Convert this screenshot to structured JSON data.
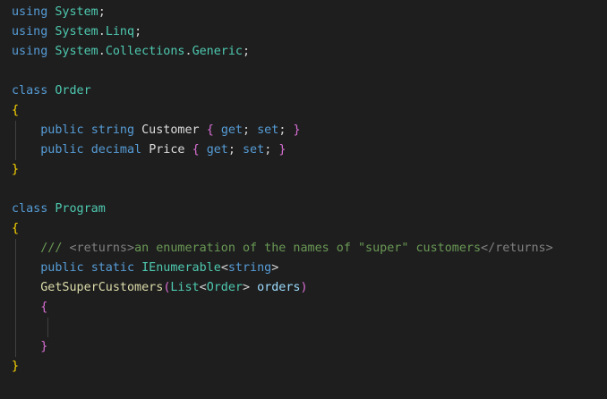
{
  "theme": {
    "background": "#1e1e1e",
    "keyword": "#569cd6",
    "type": "#4ec9b0",
    "method": "#dcdcaa",
    "parameter": "#9cdcfe",
    "comment": "#6a9955",
    "bracket_level_1": "#ffd700",
    "bracket_level_2": "#da70d6",
    "bracket_level_3": "#179fff"
  },
  "code": {
    "lines": [
      [
        {
          "t": "using",
          "c": "kw"
        },
        {
          "t": " "
        },
        {
          "t": "System",
          "c": "type"
        },
        {
          "t": ";"
        }
      ],
      [
        {
          "t": "using",
          "c": "kw"
        },
        {
          "t": " "
        },
        {
          "t": "System",
          "c": "type"
        },
        {
          "t": "."
        },
        {
          "t": "Linq",
          "c": "type"
        },
        {
          "t": ";"
        }
      ],
      [
        {
          "t": "using",
          "c": "kw"
        },
        {
          "t": " "
        },
        {
          "t": "System",
          "c": "type"
        },
        {
          "t": "."
        },
        {
          "t": "Collections",
          "c": "type"
        },
        {
          "t": "."
        },
        {
          "t": "Generic",
          "c": "type"
        },
        {
          "t": ";"
        }
      ],
      [],
      [
        {
          "t": "class",
          "c": "kw"
        },
        {
          "t": " "
        },
        {
          "t": "Order",
          "c": "type"
        }
      ],
      [
        {
          "t": "{",
          "c": "b1"
        }
      ],
      [
        {
          "t": "    "
        },
        {
          "t": "public",
          "c": "kw"
        },
        {
          "t": " "
        },
        {
          "t": "string",
          "c": "kw"
        },
        {
          "t": " "
        },
        {
          "t": "Customer",
          "c": "prop"
        },
        {
          "t": " "
        },
        {
          "t": "{",
          "c": "b2"
        },
        {
          "t": " "
        },
        {
          "t": "get",
          "c": "kw"
        },
        {
          "t": "; "
        },
        {
          "t": "set",
          "c": "kw"
        },
        {
          "t": "; "
        },
        {
          "t": "}",
          "c": "b2"
        }
      ],
      [
        {
          "t": "    "
        },
        {
          "t": "public",
          "c": "kw"
        },
        {
          "t": " "
        },
        {
          "t": "decimal",
          "c": "kw"
        },
        {
          "t": " "
        },
        {
          "t": "Price",
          "c": "prop"
        },
        {
          "t": " "
        },
        {
          "t": "{",
          "c": "b2"
        },
        {
          "t": " "
        },
        {
          "t": "get",
          "c": "kw"
        },
        {
          "t": "; "
        },
        {
          "t": "set",
          "c": "kw"
        },
        {
          "t": "; "
        },
        {
          "t": "}",
          "c": "b2"
        }
      ],
      [
        {
          "t": "}",
          "c": "b1"
        }
      ],
      [],
      [
        {
          "t": "class",
          "c": "kw"
        },
        {
          "t": " "
        },
        {
          "t": "Program",
          "c": "type"
        }
      ],
      [
        {
          "t": "{",
          "c": "b1"
        }
      ],
      [
        {
          "t": "    "
        },
        {
          "t": "/// ",
          "c": "comment"
        },
        {
          "t": "<returns>",
          "c": "tag"
        },
        {
          "t": "an enumeration of the names of \"super\" customers",
          "c": "comment"
        },
        {
          "t": "</returns>",
          "c": "tag"
        }
      ],
      [
        {
          "t": "    "
        },
        {
          "t": "public",
          "c": "kw"
        },
        {
          "t": " "
        },
        {
          "t": "static",
          "c": "kw"
        },
        {
          "t": " "
        },
        {
          "t": "IEnumerable",
          "c": "type"
        },
        {
          "t": "<"
        },
        {
          "t": "string",
          "c": "kw"
        },
        {
          "t": ">"
        }
      ],
      [
        {
          "t": "    "
        },
        {
          "t": "GetSuperCustomers",
          "c": "method"
        },
        {
          "t": "(",
          "c": "b2"
        },
        {
          "t": "List",
          "c": "type"
        },
        {
          "t": "<"
        },
        {
          "t": "Order",
          "c": "type"
        },
        {
          "t": "> "
        },
        {
          "t": "orders",
          "c": "param"
        },
        {
          "t": ")",
          "c": "b2"
        }
      ],
      [
        {
          "t": "    "
        },
        {
          "t": "{",
          "c": "b2"
        }
      ],
      [],
      [
        {
          "t": "    "
        },
        {
          "t": "}",
          "c": "b2"
        }
      ],
      [
        {
          "t": "}",
          "c": "b1"
        }
      ]
    ]
  }
}
